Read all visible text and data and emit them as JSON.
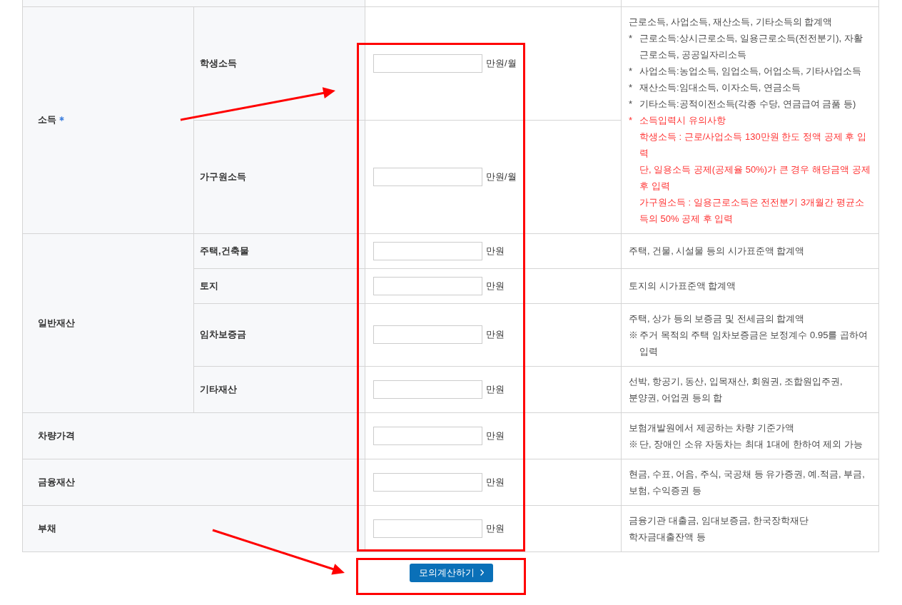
{
  "sections": [
    {
      "label": "소득",
      "required": true,
      "items": [
        {
          "label": "학생소득",
          "unit": "만원/월"
        },
        {
          "label": "가구원소득",
          "unit": "만원/월"
        }
      ],
      "note": [
        {
          "kind": "plain",
          "text": "근로소득, 사업소득, 재산소득, 기타소득의 합계액"
        },
        {
          "kind": "plain",
          "marker": "*",
          "text": "근로소득:상시근로소득, 일용근로소득(전전분기), 자활근로소득, 공공일자리소득"
        },
        {
          "kind": "plain",
          "marker": "*",
          "text": "사업소득:농업소득, 임업소득, 어업소득, 기타사업소득"
        },
        {
          "kind": "plain",
          "marker": "*",
          "text": "재산소득:임대소득, 이자소득, 연금소득"
        },
        {
          "kind": "plain",
          "marker": "*",
          "text": "기타소득:공적이전소득(각종 수당, 연금급여 금품 등)"
        },
        {
          "kind": "warning",
          "marker": "*",
          "text": "소득입력시 유의사항",
          "children": [
            {
              "kind": "warning",
              "text": "학생소득 : 근로/사업소득 130만원 한도 정액 공제 후 입력"
            },
            {
              "kind": "warning",
              "text": "단, 일용소득 공제(공제율 50%)가 큰 경우 해당금액 공제 후 입력"
            },
            {
              "kind": "warning",
              "text": "가구원소득 : 일용근로소득은 전전분기 3개월간 평균소득의 50% 공제 후 입력"
            }
          ]
        }
      ]
    },
    {
      "label": "일반재산",
      "required": false,
      "items": [
        {
          "label": "주택,건축물",
          "unit": "만원",
          "note": [
            {
              "kind": "plain",
              "text": "주택, 건물, 시설물 등의 시가표준액 합계액"
            }
          ]
        },
        {
          "label": "토지",
          "unit": "만원",
          "note": [
            {
              "kind": "plain",
              "text": "토지의 시가표준액 합계액"
            }
          ]
        },
        {
          "label": "임차보증금",
          "unit": "만원",
          "note": [
            {
              "kind": "plain",
              "text": "주택, 상가 등의 보증금 및 전세금의 합계액"
            },
            {
              "kind": "plain",
              "marker": "※",
              "text": "주거 목적의 주택 임차보증금은 보정계수 0.95를 곱하여 입력"
            }
          ]
        },
        {
          "label": "기타재산",
          "unit": "만원",
          "note": [
            {
              "kind": "plain",
              "text": "선박, 항공기, 동산, 입목재산, 회원권, 조합원입주권,"
            },
            {
              "kind": "plain",
              "text": "분양권, 어업권 등의 합"
            }
          ]
        }
      ]
    },
    {
      "label": "차량가격",
      "required": false,
      "unit": "만원",
      "note": [
        {
          "kind": "plain",
          "text": "보험개발원에서 제공하는 차량 기준가액"
        },
        {
          "kind": "plain",
          "marker": "※",
          "text": "단, 장애인 소유 자동차는 최대 1대에 한하여 제외 가능"
        }
      ]
    },
    {
      "label": "금융재산",
      "required": false,
      "unit": "만원",
      "note": [
        {
          "kind": "plain",
          "text": "현금, 수표, 어음, 주식, 국공채 등 유가증권, 예.적금, 부금,"
        },
        {
          "kind": "plain",
          "text": "보험, 수익증권 등"
        }
      ]
    },
    {
      "label": "부채",
      "required": false,
      "unit": "만원",
      "note": [
        {
          "kind": "plain",
          "text": "금융기관 대출금, 임대보증금, 한국장학재단"
        },
        {
          "kind": "plain",
          "text": "학자금대출잔액 등"
        }
      ]
    }
  ],
  "button": {
    "label": "모의계산하기"
  }
}
